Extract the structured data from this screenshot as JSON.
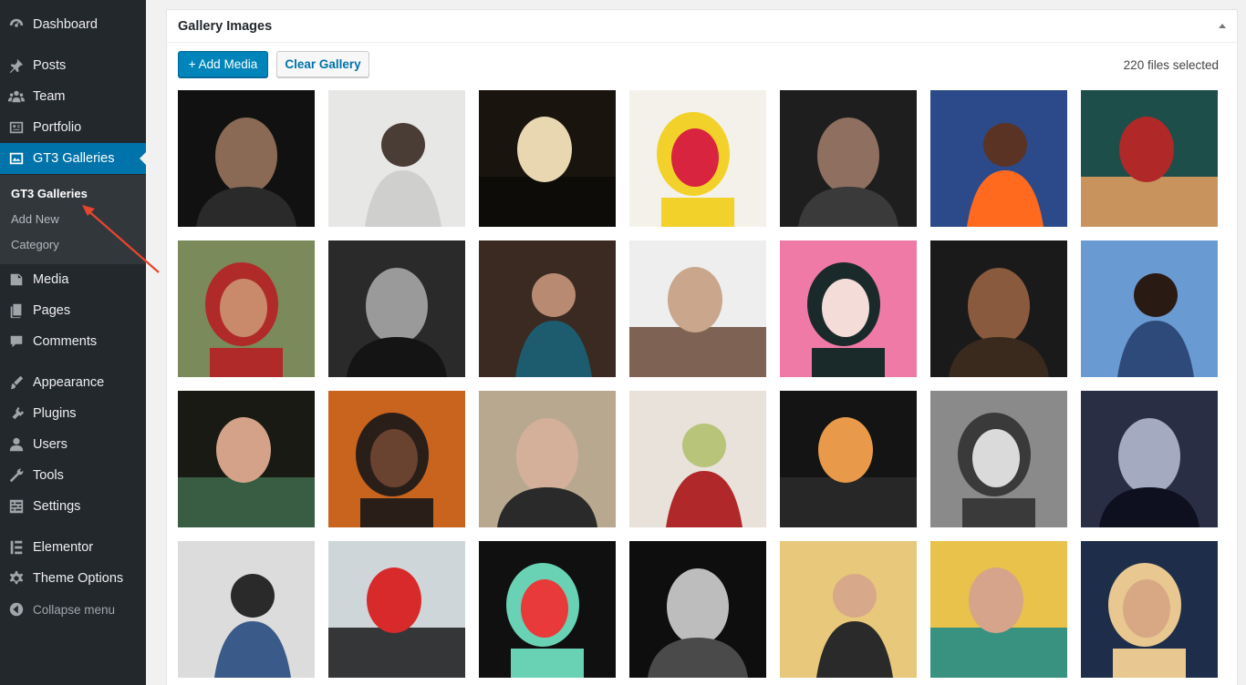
{
  "sidebar": {
    "items": [
      {
        "label": "Dashboard",
        "icon": "dashboard-icon"
      },
      {
        "label": "Posts",
        "icon": "pin-icon"
      },
      {
        "label": "Team",
        "icon": "groups-icon"
      },
      {
        "label": "Portfolio",
        "icon": "portfolio-icon"
      },
      {
        "label": "GT3 Galleries",
        "icon": "gallery-icon"
      },
      {
        "label": "Media",
        "icon": "media-icon"
      },
      {
        "label": "Pages",
        "icon": "pages-icon"
      },
      {
        "label": "Comments",
        "icon": "comment-icon"
      },
      {
        "label": "Appearance",
        "icon": "brush-icon"
      },
      {
        "label": "Plugins",
        "icon": "plugin-icon"
      },
      {
        "label": "Users",
        "icon": "user-icon"
      },
      {
        "label": "Tools",
        "icon": "wrench-icon"
      },
      {
        "label": "Settings",
        "icon": "settings-icon"
      },
      {
        "label": "Elementor",
        "icon": "elementor-icon"
      },
      {
        "label": "Theme Options",
        "icon": "gear-icon"
      },
      {
        "label": "Collapse menu",
        "icon": "collapse-icon"
      }
    ],
    "submenu": [
      "GT3 Galleries",
      "Add New",
      "Category"
    ]
  },
  "gallery": {
    "title": "Gallery Images",
    "add_media_label": "+ Add Media",
    "clear_gallery_label": "Clear Gallery",
    "files_selected": "220 files selected",
    "images": [
      {
        "name": "portrait-bearded-man-smiling",
        "bg": "#111111",
        "fg": "#8a6a55",
        "accent": "#2a2a2a"
      },
      {
        "name": "woman-near-wall-light",
        "bg": "#e7e7e5",
        "fg": "#4a3d35",
        "accent": "#cfcfcd"
      },
      {
        "name": "couple-silhouette-sunset",
        "bg": "#1a140e",
        "fg": "#e8d7b0",
        "accent": "#0c0a07"
      },
      {
        "name": "old-woman-sombrero",
        "bg": "#f4f1ea",
        "fg": "#d8243e",
        "accent": "#f2d22a"
      },
      {
        "name": "tattooed-hands-rings",
        "bg": "#1e1e1e",
        "fg": "#8f6f5f",
        "accent": "#3a3a3a"
      },
      {
        "name": "man-neon-sunglasses",
        "bg": "#2c4a8a",
        "fg": "#5a3324",
        "accent": "#ff6a1f"
      },
      {
        "name": "woman-neon-red-top",
        "bg": "#1e4e4a",
        "fg": "#b02828",
        "accent": "#e8a060"
      },
      {
        "name": "woman-glasses-red-top",
        "bg": "#7a8a5a",
        "fg": "#c88a6a",
        "accent": "#b02a2a"
      },
      {
        "name": "bw-man-long-hair",
        "bg": "#2a2a2a",
        "fg": "#9a9a9a",
        "accent": "#141414"
      },
      {
        "name": "woman-eyes-scarf",
        "bg": "#3a2a22",
        "fg": "#b88a72",
        "accent": "#1d5c6e"
      },
      {
        "name": "woman-mirror-pose",
        "bg": "#eeeeee",
        "fg": "#c9a68c",
        "accent": "#6a4a38"
      },
      {
        "name": "upside-down-headphones-pink",
        "bg": "#f07aa6",
        "fg": "#f4dcd8",
        "accent": "#1a2a2a"
      },
      {
        "name": "curly-hair-woman-dark",
        "bg": "#1a1a1a",
        "fg": "#8a5a3e",
        "accent": "#3a2a1e"
      },
      {
        "name": "man-denim-sky",
        "bg": "#6a9ad2",
        "fg": "#2a1a14",
        "accent": "#2e4a7a"
      },
      {
        "name": "woman-leaf-smile",
        "bg": "#1a1a14",
        "fg": "#d4a288",
        "accent": "#3e6a4a"
      },
      {
        "name": "woman-orange-interior",
        "bg": "#c8641e",
        "fg": "#6a4230",
        "accent": "#2a1e18"
      },
      {
        "name": "woman-sunglasses-chair",
        "bg": "#b8a890",
        "fg": "#d4b09a",
        "accent": "#2a2a2a"
      },
      {
        "name": "woman-vintage-beetle",
        "bg": "#e8e2da",
        "fg": "#b8c47a",
        "accent": "#b0282a"
      },
      {
        "name": "shadow-stripes-profile",
        "bg": "#141414",
        "fg": "#e89a4a",
        "accent": "#2a2a2a"
      },
      {
        "name": "bw-old-man-beard",
        "bg": "#8a8a8a",
        "fg": "#dadada",
        "accent": "#3a3a3a"
      },
      {
        "name": "couple-window-silhouette",
        "bg": "#2a2e44",
        "fg": "#a4aac0",
        "accent": "#0e1020"
      },
      {
        "name": "woman-jumping-wall",
        "bg": "#dcdcdc",
        "fg": "#2a2a2a",
        "accent": "#3a5a8a"
      },
      {
        "name": "woman-bob-red-blouse",
        "bg": "#cfd6da",
        "fg": "#d82a2a",
        "accent": "#1a1a1a"
      },
      {
        "name": "neon-light-tubes",
        "bg": "#101010",
        "fg": "#e83a3a",
        "accent": "#6ad2b4"
      },
      {
        "name": "bw-two-women-faces",
        "bg": "#0e0e0e",
        "fg": "#bdbdbd",
        "accent": "#4a4a4a"
      },
      {
        "name": "blonde-woman-yellow",
        "bg": "#e8c87a",
        "fg": "#d8a88a",
        "accent": "#2a2a2a"
      },
      {
        "name": "woman-heart-glasses-yellow",
        "bg": "#e8c24a",
        "fg": "#d6a48a",
        "accent": "#1a8a8a"
      },
      {
        "name": "curly-blonde-woman",
        "bg": "#1e2e4a",
        "fg": "#d8a884",
        "accent": "#e8c890"
      }
    ]
  }
}
